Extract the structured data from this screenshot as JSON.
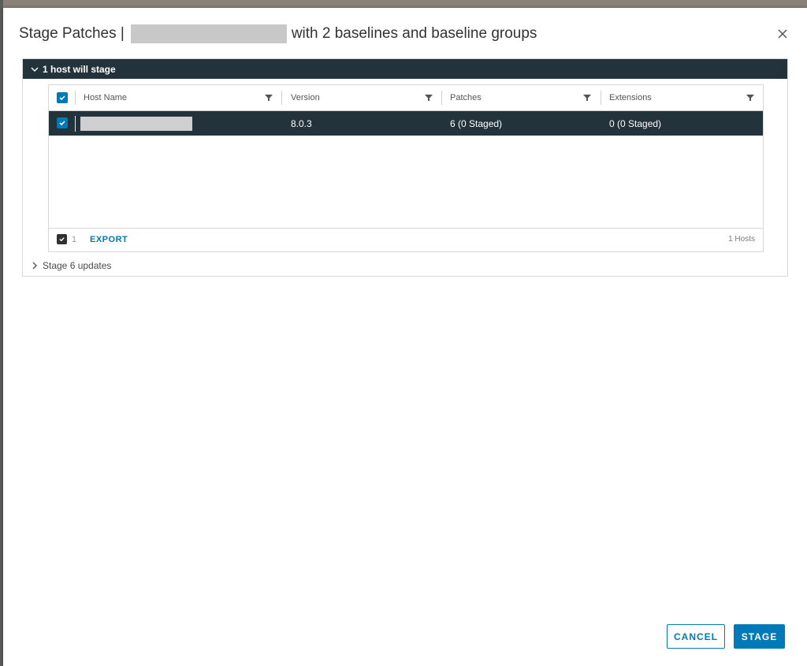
{
  "dialog": {
    "title_prefix": "Stage Patches |",
    "title_suffix": "with 2 baselines and baseline groups"
  },
  "sections": {
    "hosts": {
      "label": "1 host will stage",
      "expanded": true
    },
    "updates": {
      "label": "Stage 6 updates",
      "expanded": false
    }
  },
  "grid": {
    "columns": [
      "Host Name",
      "Version",
      "Patches",
      "Extensions"
    ],
    "rows": [
      {
        "host": "",
        "version": "8.0.3",
        "patches": "6 (0 Staged)",
        "extensions": "0 (0 Staged)",
        "selected": true
      }
    ],
    "footer": {
      "selected_count": "1",
      "export_label": "EXPORT",
      "total": "1 Hosts"
    }
  },
  "buttons": {
    "cancel": "CANCEL",
    "stage": "STAGE"
  },
  "colors": {
    "accent": "#0079b8",
    "header_dark": "#22333c"
  },
  "icons": {
    "close": "close-icon",
    "filter": "filter-icon",
    "expand": "chevron-down-icon",
    "collapse": "chevron-right-icon"
  }
}
